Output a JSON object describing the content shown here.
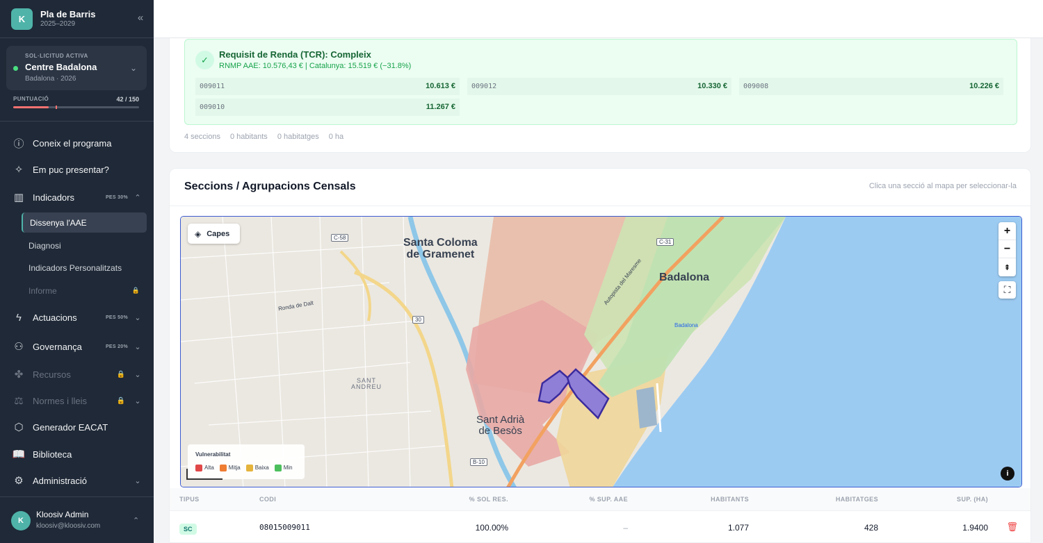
{
  "sidebar": {
    "brand_initial": "K",
    "brand_title": "Pla de Barris",
    "brand_subtitle": "2025–2029",
    "active_request": {
      "kicker": "SOL·LICITUD ACTIVA",
      "title": "Centre Badalona",
      "subtitle": "Badalona · 2026"
    },
    "score": {
      "label": "PUNTUACIÓ",
      "value": "42 / 150",
      "fraction": 0.28
    },
    "nav": {
      "coneix": "Coneix el programa",
      "presentar": "Em puc presentar?",
      "indicadors": "Indicadors",
      "indicadors_badge": "PES 30%",
      "sub_dissenya": "Dissenya l'AAE",
      "sub_diagnosi": "Diagnosi",
      "sub_personalitzats": "Indicadors Personalitzats",
      "sub_informe": "Informe",
      "actuacions": "Actuacions",
      "actuacions_badge": "PES 50%",
      "governanca": "Governança",
      "governanca_badge": "PES 20%",
      "recursos": "Recursos",
      "normes": "Normes i lleis",
      "generador": "Generador EACAT",
      "biblioteca": "Biblioteca",
      "administracio": "Administració"
    },
    "user": {
      "initial": "K",
      "name": "Kloosiv Admin",
      "email": "kloosiv@kloosiv.com"
    }
  },
  "tcr": {
    "title": "Requisit de Renda (TCR): Compleix",
    "subtitle": "RNMP AAE: 10.576,43 €  |  Catalunya: 15.519 €  (−31.8%)",
    "cells": [
      {
        "code": "009011",
        "value": "10.613 €"
      },
      {
        "code": "009012",
        "value": "10.330 €"
      },
      {
        "code": "009008",
        "value": "10.226 €"
      },
      {
        "code": "009010",
        "value": "11.267 €"
      }
    ],
    "stats": {
      "seccions": "4 seccions",
      "habitants": "0 habitants",
      "habitatges": "0 habitatges",
      "ha": "0 ha"
    }
  },
  "section": {
    "title": "Seccions / Agrupacions Censals",
    "hint": "Clica una secció al mapa per seleccionar-la"
  },
  "map": {
    "capes_label": "Capes",
    "labels": {
      "santa_coloma": "Santa Coloma\nde Gramenet",
      "badalona": "Badalona",
      "badalona_station": "Badalona",
      "sant_andreu": "SANT\nANDREU",
      "sant_adria": "Sant Adrià\nde Besòs",
      "ronda": "Ronda de Dalt",
      "autopista": "Autopista del Maresme"
    },
    "roads": {
      "c58": "C-58",
      "c31": "C-31",
      "r30": "30",
      "b10": "B-10"
    },
    "legend": {
      "title": "Vulnerabilitat",
      "items": [
        {
          "label": "Alta",
          "color": "#e04848"
        },
        {
          "label": "Mitja",
          "color": "#ef7d32"
        },
        {
          "label": "Baixa",
          "color": "#e5b43c"
        },
        {
          "label": "Min",
          "color": "#4cbf5c"
        }
      ]
    }
  },
  "table": {
    "headers": {
      "tipus": "TIPUS",
      "codi": "CODI",
      "sol": "% SOL RES.",
      "sup_aae": "% SUP. AAE",
      "habitants": "HABITANTS",
      "habitatges": "HABITATGES",
      "sup_ha": "SUP. (HA)"
    },
    "row": {
      "tipus": "SC",
      "codi": "08015009011",
      "sol": "100.00%",
      "sup_aae": "–",
      "habitants": "1.077",
      "habitatges": "428",
      "sup_ha": "1.9400"
    }
  }
}
